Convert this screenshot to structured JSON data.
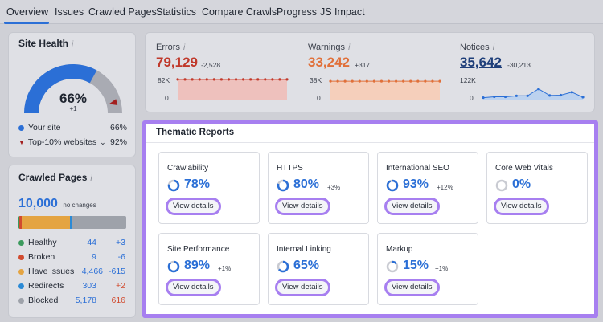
{
  "nav": {
    "tabs": [
      "Overview",
      "Issues",
      "Crawled Pages",
      "Statistics",
      "Compare Crawls",
      "Progress",
      "JS Impact"
    ],
    "active": "Overview"
  },
  "site_health": {
    "title": "Site Health",
    "info": "i",
    "percent": "66%",
    "delta": "+1",
    "gauge_fraction": 0.66,
    "top10_fraction": 0.92,
    "legend": [
      {
        "label": "Your site",
        "value": "66%",
        "marker": "dot",
        "color": "#2b6fd6"
      },
      {
        "label": "Top-10% websites",
        "value": "92%",
        "marker": "triangle",
        "color": "#c0392b",
        "has_dropdown": true
      }
    ]
  },
  "crawled_pages": {
    "title": "Crawled Pages",
    "info": "i",
    "total": "10,000",
    "total_note": "no changes",
    "rows": [
      {
        "label": "Healthy",
        "count": "44",
        "delta": "+3",
        "color": "#3b9a5d",
        "delta_color": "#2b6fd6"
      },
      {
        "label": "Broken",
        "count": "9",
        "delta": "-6",
        "color": "#d14b2f",
        "delta_color": "#2b6fd6"
      },
      {
        "label": "Have issues",
        "count": "4,466",
        "delta": "-615",
        "color": "#e4a442",
        "delta_color": "#2b6fd6"
      },
      {
        "label": "Redirects",
        "count": "303",
        "delta": "+2",
        "color": "#2b8ad6",
        "delta_color": "#d14b2f"
      },
      {
        "label": "Blocked",
        "count": "5,178",
        "delta": "+616",
        "color": "#9ea2aa",
        "delta_color": "#d14b2f"
      }
    ]
  },
  "metrics": [
    {
      "label": "Errors",
      "info": "i",
      "value": "79,129",
      "delta": "-2,528",
      "color": "#c0392b",
      "fill": "#eec1bd",
      "axis_top": "82K",
      "axis_bottom": "0",
      "series": [
        79129,
        79129,
        79129,
        79129,
        79129,
        79129,
        79129,
        79129,
        79129,
        79129,
        79129,
        79129,
        79129,
        79129,
        79129,
        79129
      ]
    },
    {
      "label": "Warnings",
      "info": "i",
      "value": "33,242",
      "delta": "+317",
      "color": "#e0703a",
      "fill": "#f5cfbb",
      "axis_top": "38K",
      "axis_bottom": "0",
      "series": [
        33242,
        33242,
        33242,
        33242,
        33242,
        33242,
        33242,
        33242,
        33242,
        33242,
        33242,
        33242,
        33242,
        33242,
        33242,
        33242
      ]
    },
    {
      "label": "Notices",
      "info": "i",
      "value": "35,642",
      "delta": "-30,213",
      "color": "#2b6fd6",
      "fill": "#bcd2ef",
      "axis_top": "122K",
      "axis_bottom": "0",
      "series": [
        7000,
        12000,
        12000,
        18000,
        18000,
        60000,
        20000,
        22000,
        40000,
        10000
      ]
    }
  ],
  "thematic": {
    "title": "Thematic Reports",
    "reports": [
      {
        "name": "Crawlability",
        "percent": "78%",
        "delta": "",
        "fraction": 0.78
      },
      {
        "name": "HTTPS",
        "percent": "80%",
        "delta": "+3%",
        "fraction": 0.8
      },
      {
        "name": "International SEO",
        "percent": "93%",
        "delta": "+12%",
        "fraction": 0.93
      },
      {
        "name": "Core Web Vitals",
        "percent": "0%",
        "delta": "",
        "fraction": 0
      },
      {
        "name": "Site Performance",
        "percent": "89%",
        "delta": "+1%",
        "fraction": 0.89
      },
      {
        "name": "Internal Linking",
        "percent": "65%",
        "delta": "",
        "fraction": 0.65
      },
      {
        "name": "Markup",
        "percent": "15%",
        "delta": "+1%",
        "fraction": 0.15
      }
    ],
    "view_details_label": "View details"
  }
}
